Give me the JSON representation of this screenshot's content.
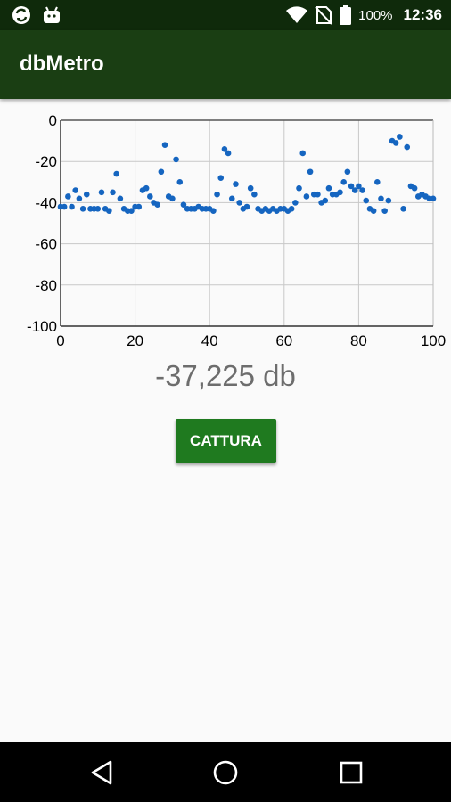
{
  "status_bar": {
    "battery_percent": "100%",
    "time": "12:36",
    "icons": [
      "sync-icon",
      "android-icon",
      "wifi-icon",
      "no-sim-icon",
      "battery-icon"
    ]
  },
  "app": {
    "title": "dbMetro",
    "header_color": "#1a3e13",
    "accent_color": "#1f7a1f"
  },
  "chart_data": {
    "type": "scatter",
    "title": "",
    "xlabel": "",
    "ylabel": "",
    "xlim": [
      0,
      100
    ],
    "ylim": [
      -100,
      0
    ],
    "x_ticks": [
      "0",
      "20",
      "40",
      "60",
      "80",
      "100"
    ],
    "y_ticks": [
      "0",
      "-20",
      "-40",
      "-60",
      "-80",
      "-100"
    ],
    "grid": true,
    "point_color": "#1565c0",
    "series": [
      {
        "x": [
          0,
          1,
          2,
          3,
          4,
          5,
          6,
          7,
          8,
          9,
          10,
          11,
          12,
          13,
          14,
          15,
          16,
          17,
          18,
          19,
          20,
          21,
          22,
          23,
          24,
          25,
          26,
          27,
          28,
          29,
          30,
          31,
          32,
          33,
          34,
          35,
          36,
          37,
          38,
          39,
          40,
          41,
          42,
          43,
          44,
          45,
          46,
          47,
          48,
          49,
          50,
          51,
          52,
          53,
          54,
          55,
          56,
          57,
          58,
          59,
          60,
          61,
          62,
          63,
          64,
          65,
          66,
          67,
          68,
          69,
          70,
          71,
          72,
          73,
          74,
          75,
          76,
          77,
          78,
          79,
          80,
          81,
          82,
          83,
          84,
          85,
          86,
          87,
          88,
          89,
          90,
          91,
          92,
          93,
          94,
          95,
          96,
          97,
          98,
          99,
          100
        ],
        "y": [
          -42,
          -42,
          -37,
          -42,
          -34,
          -38,
          -43,
          -36,
          -43,
          -43,
          -43,
          -35,
          -43,
          -44,
          -35,
          -26,
          -38,
          -43,
          -44,
          -44,
          -42,
          -42,
          -34,
          -33,
          -37,
          -40,
          -41,
          -25,
          -12,
          -37,
          -38,
          -19,
          -30,
          -41,
          -43,
          -43,
          -43,
          -42,
          -43,
          -43,
          -43,
          -44,
          -36,
          -28,
          -14,
          -16,
          -38,
          -31,
          -40,
          -43,
          -42,
          -33,
          -36,
          -43,
          -44,
          -43,
          -44,
          -43,
          -44,
          -43,
          -43,
          -44,
          -43,
          -40,
          -33,
          -16,
          -37,
          -25,
          -36,
          -36,
          -40,
          -39,
          -33,
          -36,
          -36,
          -35,
          -30,
          -25,
          -32,
          -34,
          -32,
          -34,
          -39,
          -43,
          -44,
          -30,
          -38,
          -44,
          -39,
          -10,
          -11,
          -8,
          -43,
          -13,
          -32,
          -33,
          -37,
          -36,
          -37,
          -38,
          -38
        ]
      }
    ]
  },
  "readout": "-37,225 db",
  "capture_button": {
    "label": "CATTURA"
  },
  "nav_bar": {
    "buttons": [
      "back-icon",
      "home-icon",
      "recents-icon"
    ]
  }
}
